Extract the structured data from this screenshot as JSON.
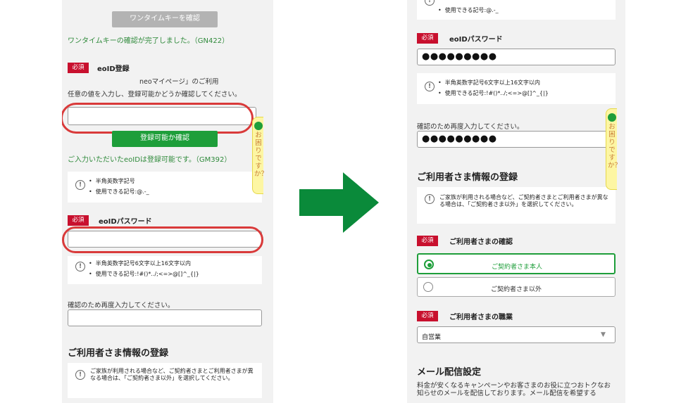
{
  "left": {
    "onetime_button": "ワンタイムキーを確認",
    "onetime_done": "ワンタイムキーの確認が完了しました。（GN422）",
    "req_badge": "必須",
    "eoid_label": "eoID登録",
    "eoid_desc_line1": "neoマイページ」のご利用",
    "eoid_desc_line2": "任意の値を入力し、登録可能かどうか確認してください。",
    "eoid_input_value": "",
    "check_button": "登録可能か確認",
    "available_msg": "ご入力いただいたeoIDは登録可能です。（GM392）",
    "eoid_rules": [
      "半角英数字記号",
      "使用できる記号:@.-_"
    ],
    "pw_label": "eoIDパスワード",
    "pw_value": "",
    "pw_rules": [
      "半角英数字記号6文字以上16文字以内",
      "使用できる記号:!#()*../;<=>@[]^_{|}"
    ],
    "confirm_label": "確認のため再度入力してください。",
    "confirm_value": "",
    "user_info_heading": "ご利用者さま情報の登録",
    "user_info_note": "ご家族が利用される場合など、ご契約者さまとご利用者さまが異なる場合は、「ご契約者さま以外」を選択してください。"
  },
  "help_tab": {
    "label": "お困りですか？"
  },
  "arrow_color": "#0a8a3a",
  "right": {
    "top_rule": "使用できる記号:@.-_",
    "req_badge": "必須",
    "pw_label": "eoIDパスワード",
    "pw_value": "●●●●●●●●●",
    "pw_rules": [
      "半角英数字記号6文字以上16文字以内",
      "使用できる記号:!#()*../;<=>@[]^_{|}"
    ],
    "confirm_label": "確認のため再度入力してください。",
    "confirm_value": "●●●●●●●●●",
    "user_info_heading": "ご利用者さま情報の登録",
    "user_info_note": "ご家族が利用される場合など、ご契約者さまとご利用者さまが異なる場合は、「ご契約者さま以外」を選択してください。",
    "user_check_label": "ご利用者さまの確認",
    "options": [
      "ご契約者さま本人",
      "ご契約者さま以外"
    ],
    "selected_option": "ご契約者さま本人",
    "job_label": "ご利用者さまの職業",
    "job_value": "自営業",
    "mail_heading": "メール配信設定",
    "mail_text": "料金が安くなるキャンペーンやお客さまのお役に立つおトクなお知らせのメールを配信しております。メール配信を希望する"
  },
  "colors": {
    "accent_green": "#1e9e3a",
    "required_red": "#c8102e",
    "highlight_red": "#d93a3a"
  }
}
